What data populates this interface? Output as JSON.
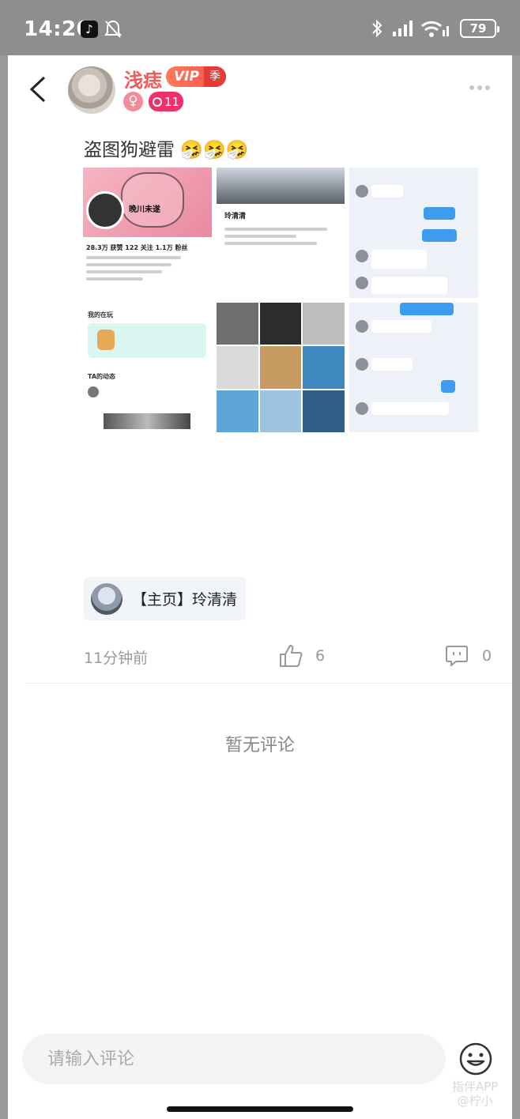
{
  "status_bar": {
    "time": "14:20",
    "battery": "79"
  },
  "header": {
    "username": "浅痣",
    "vip_label": "VIP",
    "vip_season": "季",
    "gender": "♀",
    "level": "11"
  },
  "post": {
    "text": "盗图狗避雷 🤧🤧🤧",
    "screenshots": {
      "profile_name": "晚川未遂",
      "profile_stats": "28.3万 获赞   122 关注   1.1万 粉丝",
      "playing_header": "我的在玩",
      "dynamics_header": "TA的动态",
      "other_name": "玲清清"
    },
    "linked_page": "【主页】玲清清",
    "time_ago": "11分钟前",
    "like_count": "6",
    "comment_count": "0"
  },
  "comments": {
    "empty_text": "暂无评论"
  },
  "composer": {
    "placeholder": "请输入评论"
  },
  "watermark": {
    "line1": "指伴APP",
    "line2": "@柠小"
  },
  "colors": {
    "accent_red": "#f05a5a",
    "level_pink": "#f0306a",
    "chat_blue": "#3c9cf0"
  }
}
